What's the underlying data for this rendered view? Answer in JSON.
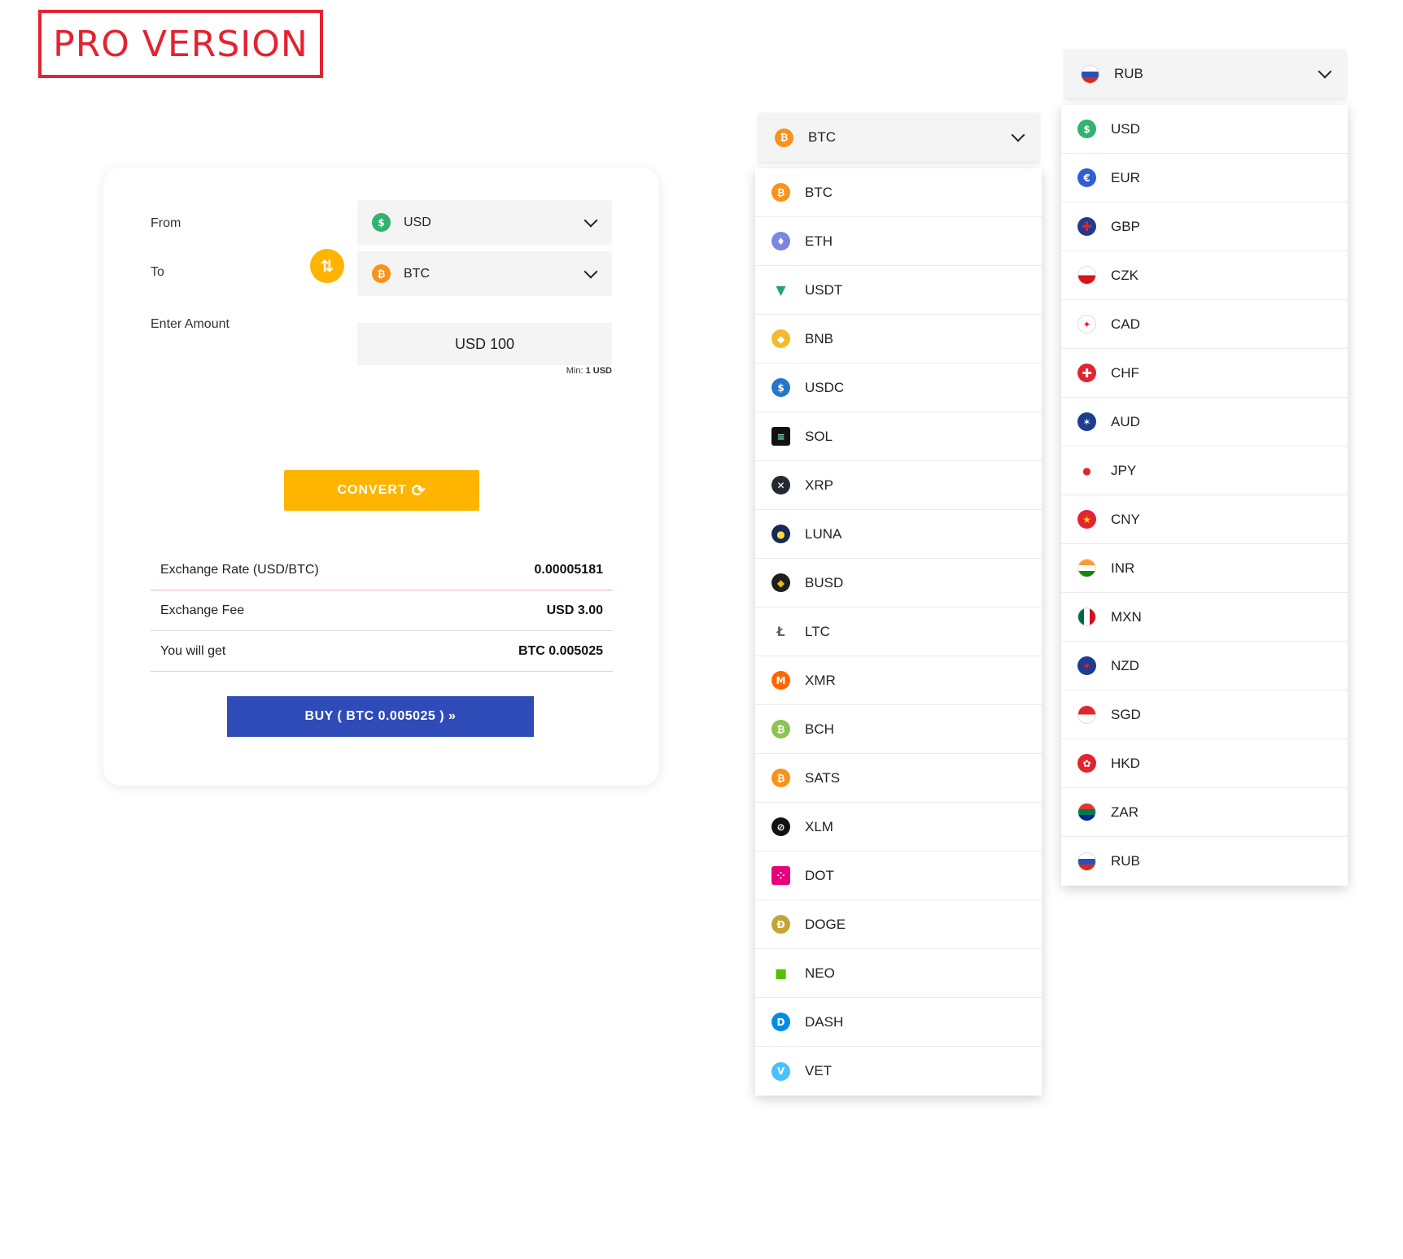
{
  "badge": {
    "label": "PRO VERSION"
  },
  "converter": {
    "from_label": "From",
    "to_label": "To",
    "amount_label": "Enter Amount",
    "from_value": "USD",
    "to_value": "BTC",
    "amount_value": "USD 100",
    "min_prefix": "Min:",
    "min_value": "1 USD",
    "convert_label": "CONVERT",
    "rows": [
      {
        "label": "Exchange Rate (USD/BTC)",
        "value": "0.00005181"
      },
      {
        "label": "Exchange Fee",
        "value": "USD 3.00"
      },
      {
        "label": "You will get",
        "value": "BTC 0.005025"
      }
    ],
    "buy_label": "BUY ( BTC 0.005025 ) »"
  },
  "crypto_dropdown": {
    "selected": "BTC",
    "items": [
      "BTC",
      "ETH",
      "USDT",
      "BNB",
      "USDC",
      "SOL",
      "XRP",
      "LUNA",
      "BUSD",
      "LTC",
      "XMR",
      "BCH",
      "SATS",
      "XLM",
      "DOT",
      "DOGE",
      "NEO",
      "DASH",
      "VET"
    ]
  },
  "fiat_dropdown": {
    "selected": "RUB",
    "items": [
      "USD",
      "EUR",
      "GBP",
      "CZK",
      "CAD",
      "CHF",
      "AUD",
      "JPY",
      "CNY",
      "INR",
      "MXN",
      "NZD",
      "SGD",
      "HKD",
      "ZAR",
      "RUB"
    ]
  },
  "colors": {
    "accent": "#ffb400",
    "buy": "#2f4bb8",
    "badge": "#e32330"
  }
}
